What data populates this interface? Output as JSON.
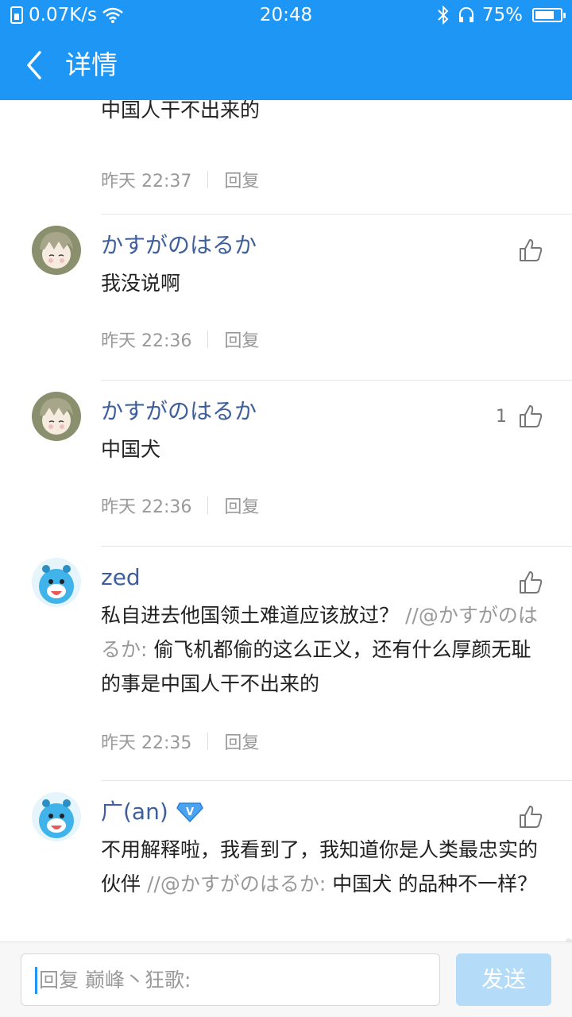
{
  "status_bar": {
    "net_speed": "0.07K/s",
    "time": "20:48",
    "battery_level": 0.75,
    "battery": "75%"
  },
  "header": {
    "title": "详情"
  },
  "comments": [
    {
      "name": "",
      "body": "偷飞机都偷的这么正义，还有什么厚颜无耻的事是中国人干不出来的",
      "time": "昨天 22:37",
      "reply": "回复"
    },
    {
      "name": "かすがのはるか",
      "body": "我没说啊",
      "time": "昨天 22:36",
      "reply": "回复",
      "likes": ""
    },
    {
      "name": "かすがのはるか",
      "body": "中国犬",
      "time": "昨天 22:36",
      "reply": "回复",
      "likes": "1"
    },
    {
      "name": "zed",
      "body": "私自进去他国领土难道应该放过？",
      "quote": "//@かすがのはるか:",
      "quote_text": "偷飞机都偷的这么正义，还有什么厚颜无耻的事是中国人干不出来的",
      "time": "昨天 22:35",
      "reply": "回复",
      "likes": ""
    },
    {
      "name": "广(an)",
      "badge": "V",
      "body": "不用解释啦，我看到了，我知道你是人类最忠实的伙伴",
      "quote": "//@かすがのはるか:",
      "quote_text": "中国犬 的品种不一样？",
      "likes": ""
    }
  ],
  "input": {
    "placeholder": "回复 巅峰丶狂歌:"
  },
  "send_button": {
    "label": "发送"
  },
  "colors": {
    "brand": "#1e96f5",
    "name": "#3e5f9c",
    "send_disabled": "#b4dcf9"
  }
}
